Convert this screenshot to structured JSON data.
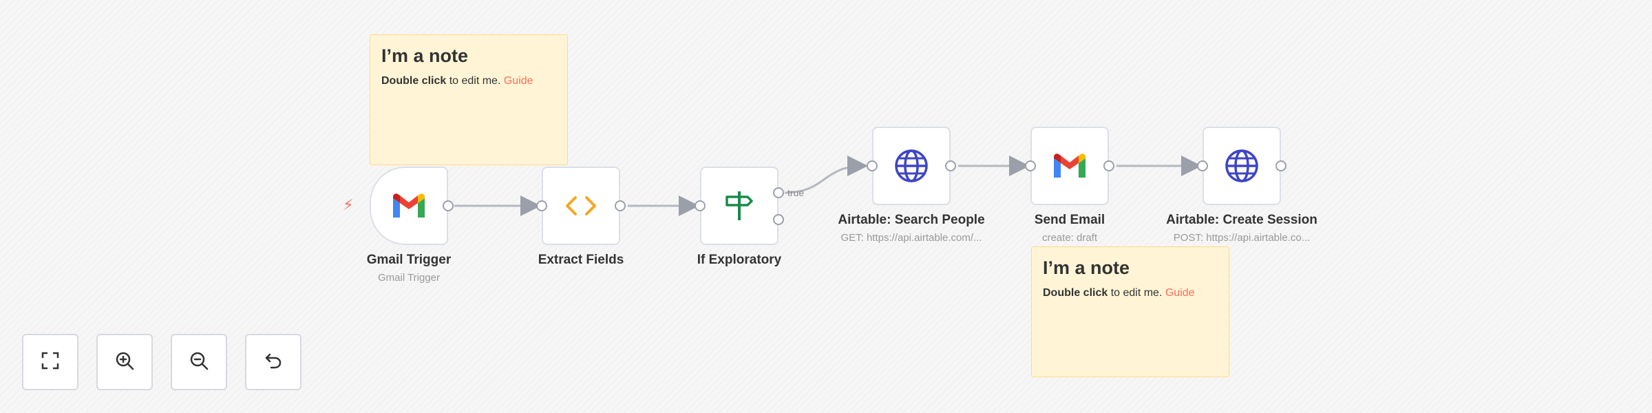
{
  "notes": [
    {
      "title": "I’m a note",
      "bold": "Double click",
      "text": " to edit me. ",
      "link": "Guide"
    },
    {
      "title": "I’m a note",
      "bold": "Double click",
      "text": " to edit me. ",
      "link": "Guide"
    }
  ],
  "nodes": {
    "gmail_trigger": {
      "label": "Gmail Trigger",
      "sub": "Gmail Trigger",
      "icon": "gmail-icon"
    },
    "extract_fields": {
      "label": "Extract Fields",
      "icon": "code-icon"
    },
    "if_exploratory": {
      "label": "If Exploratory",
      "icon": "signpost-icon",
      "branch_true": "true"
    },
    "airtable_search": {
      "label": "Airtable: Search People",
      "sub": "GET: https://api.airtable.com/...",
      "icon": "globe-icon"
    },
    "send_email": {
      "label": "Send Email",
      "sub": "create: draft",
      "icon": "gmail-icon"
    },
    "airtable_create": {
      "label": "Airtable: Create Session",
      "sub": "POST: https://api.airtable.co...",
      "icon": "globe-icon"
    }
  },
  "controls": [
    {
      "name": "fit-view",
      "icon": "fullscreen-icon"
    },
    {
      "name": "zoom-in",
      "icon": "zoom-in-icon"
    },
    {
      "name": "zoom-out",
      "icon": "zoom-out-icon"
    },
    {
      "name": "reset",
      "icon": "undo-icon"
    }
  ],
  "colors": {
    "accent": "#ff6d5a",
    "note_bg": "#fff5d6",
    "note_border": "#ffd98e",
    "node_border": "#dbdfe7",
    "globe": "#3e45c6",
    "code": "#f5a623",
    "signpost": "#1a8a4a"
  }
}
